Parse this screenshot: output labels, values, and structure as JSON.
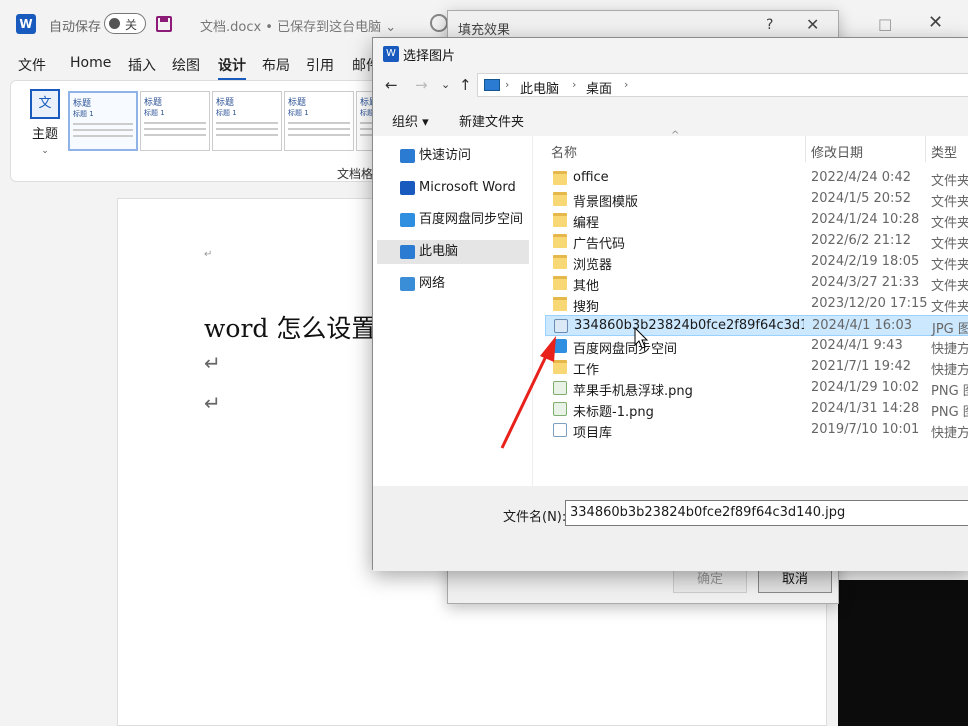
{
  "word": {
    "autosave_label": "自动保存",
    "autosave_state": "关",
    "doc_title": "文档.docx • 已保存到这台电脑 ⌄",
    "menu_tabs": [
      "文件",
      "Home",
      "插入",
      "绘图",
      "设计",
      "布局",
      "引用",
      "邮件"
    ],
    "active_tab": "设计",
    "theme_label": "主题",
    "theme_icon_text": "文",
    "doc_format_label": "文档格",
    "gallery": [
      {
        "heading": "标题",
        "sub": "标题 1"
      },
      {
        "heading": "标题",
        "sub": "标题 1"
      },
      {
        "heading": "标题",
        "sub": "标题 1"
      },
      {
        "heading": "标题",
        "sub": "标题 1"
      },
      {
        "heading": "标题",
        "sub": "标题 1"
      }
    ],
    "page_mark": "↵",
    "doc_text": "word 怎么设置",
    "return_mark": "↵"
  },
  "fill_dialog": {
    "title": "填充效果",
    "help": "?",
    "close": "✕",
    "ok": "确定",
    "cancel": "取消"
  },
  "pick_dialog": {
    "title": "选择图片",
    "logo": "W",
    "nav": {
      "back": "←",
      "forward": "→",
      "recent": "⌄",
      "up": "↑"
    },
    "breadcrumb": [
      "此电脑",
      "桌面"
    ],
    "crumb_sep": "›",
    "organize": "组织 ▾",
    "new_folder": "新建文件夹",
    "sidebar": [
      {
        "label": "快速访问",
        "icon": "star-pin-icon",
        "color": "#2a7bd1"
      },
      {
        "label": "Microsoft Word",
        "icon": "word-icon",
        "color": "#185abd"
      },
      {
        "label": "百度网盘同步空间",
        "icon": "baidu-cloud-icon",
        "color": "#2e8fe0"
      },
      {
        "label": "此电脑",
        "icon": "computer-icon",
        "color": "#2a7bd1",
        "selected": true
      },
      {
        "label": "网络",
        "icon": "network-icon",
        "color": "#3a8ed8"
      }
    ],
    "columns": {
      "name": "名称",
      "date": "修改日期",
      "type": "类型"
    },
    "files": [
      {
        "name": "office",
        "date": "2022/4/24 0:42",
        "type": "文件夹",
        "kind": "folder"
      },
      {
        "name": "背景图模版",
        "date": "2024/1/5 20:52",
        "type": "文件夹",
        "kind": "folder"
      },
      {
        "name": "编程",
        "date": "2024/1/24 10:28",
        "type": "文件夹",
        "kind": "folder"
      },
      {
        "name": "广告代码",
        "date": "2022/6/2 21:12",
        "type": "文件夹",
        "kind": "folder"
      },
      {
        "name": "浏览器",
        "date": "2024/2/19 18:05",
        "type": "文件夹",
        "kind": "folder"
      },
      {
        "name": "其他",
        "date": "2024/3/27 21:33",
        "type": "文件夹",
        "kind": "folder"
      },
      {
        "name": "搜狗",
        "date": "2023/12/20 17:15",
        "type": "文件夹",
        "kind": "folder"
      },
      {
        "name": "334860b3b23824b0fce2f89f64c3d140...",
        "date": "2024/4/1 16:03",
        "type": "JPG 图",
        "kind": "jpg",
        "selected": true
      },
      {
        "name": "百度网盘同步空间",
        "date": "2024/4/1 9:43",
        "type": "快捷方",
        "kind": "shortcut"
      },
      {
        "name": "工作",
        "date": "2021/7/1 19:42",
        "type": "快捷方",
        "kind": "folder"
      },
      {
        "name": "苹果手机悬浮球.png",
        "date": "2024/1/29 10:02",
        "type": "PNG 图",
        "kind": "png"
      },
      {
        "name": "未标题-1.png",
        "date": "2024/1/31 14:28",
        "type": "PNG 图",
        "kind": "png"
      },
      {
        "name": "项目库",
        "date": "2019/7/10 10:01",
        "type": "快捷方",
        "kind": "file"
      }
    ],
    "filename_label": "文件名(N):",
    "filename_value": "334860b3b23824b0fce2f89f64c3d140.jpg"
  },
  "colors": {
    "accent": "#185abd",
    "arrow": "#e8211b",
    "selection": "#cce8ff"
  }
}
